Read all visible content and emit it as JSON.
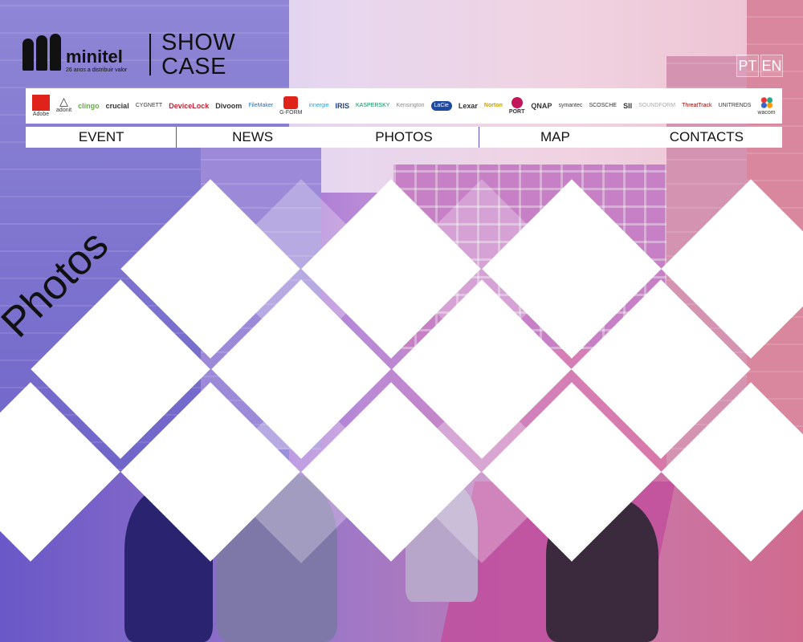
{
  "header": {
    "logo_name": "minitel",
    "logo_tagline": "26 anos a distribuir valor",
    "showcase_line1": "SHOW",
    "showcase_line2": "CASE"
  },
  "languages": [
    "PT",
    "EN"
  ],
  "brands": [
    {
      "label": "Adobe",
      "icon": "adobe-icon"
    },
    {
      "label": "adonit",
      "icon": "adonit-icon"
    },
    {
      "label": "clingo",
      "icon": ""
    },
    {
      "label": "crucial",
      "icon": ""
    },
    {
      "label": "CYGNETT",
      "icon": ""
    },
    {
      "label": "DeviceLock",
      "icon": ""
    },
    {
      "label": "Divoom",
      "icon": ""
    },
    {
      "label": "FileMaker",
      "icon": ""
    },
    {
      "label": "G-FORM",
      "icon": "g-form-icon"
    },
    {
      "label": "innergie",
      "icon": ""
    },
    {
      "label": "IRIS",
      "icon": ""
    },
    {
      "label": "KASPERSKY",
      "icon": ""
    },
    {
      "label": "Kensington",
      "icon": ""
    },
    {
      "label": "LaCie",
      "icon": ""
    },
    {
      "label": "Lexar",
      "icon": ""
    },
    {
      "label": "Norton",
      "icon": ""
    },
    {
      "label": "PORT",
      "icon": "port-icon"
    },
    {
      "label": "QNAP",
      "icon": ""
    },
    {
      "label": "symantec",
      "icon": ""
    },
    {
      "label": "SCOSCHE",
      "icon": ""
    },
    {
      "label": "SII",
      "icon": ""
    },
    {
      "label": "SOUNDFORM",
      "icon": ""
    },
    {
      "label": "ThreatTrack",
      "icon": ""
    },
    {
      "label": "UNITRENDS",
      "icon": ""
    },
    {
      "label": "wacom",
      "icon": "wacom-icon"
    }
  ],
  "nav": {
    "event": "EVENT",
    "news": "NEWS",
    "photos": "PHOTOS",
    "map": "MAP",
    "contacts": "CONTACTS"
  },
  "section_title": "Photos",
  "colors": {
    "accent_purple": "#5d4fc9",
    "accent_pink": "#dc6e95",
    "adobe_red": "#e0231a"
  }
}
